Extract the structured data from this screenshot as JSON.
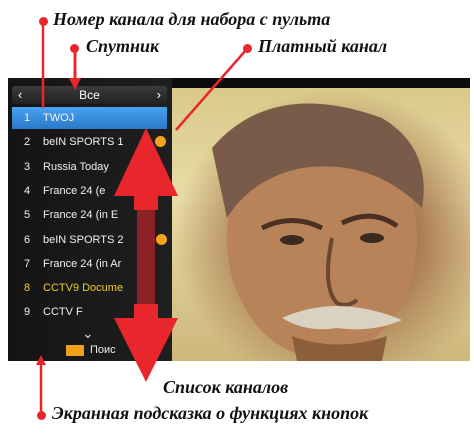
{
  "annotations": {
    "channel_number": "Номер канала для набора с пульта",
    "satellite": "Спутник",
    "paid_channel": "Платный канал",
    "channel_list": "Список каналов",
    "button_hint": "Экранная подсказка о функциях кнопок"
  },
  "satellite_selector": {
    "label": "Все",
    "prev_icon": "chevron-left-icon",
    "next_icon": "chevron-right-icon"
  },
  "channels": [
    {
      "num": "1",
      "name": "TWOJ",
      "selected": true,
      "paid": false
    },
    {
      "num": "2",
      "name": "beIN SPORTS 1",
      "selected": false,
      "paid": true
    },
    {
      "num": "3",
      "name": "Russia Today",
      "selected": false,
      "paid": false
    },
    {
      "num": "4",
      "name": "France 24 (e",
      "selected": false,
      "paid": false
    },
    {
      "num": "5",
      "name": "France 24 (in E",
      "selected": false,
      "paid": false
    },
    {
      "num": "6",
      "name": "beIN SPORTS 2",
      "selected": false,
      "paid": true
    },
    {
      "num": "7",
      "name": "France 24 (in Ar",
      "selected": false,
      "paid": false
    },
    {
      "num": "8",
      "name": "CCTV9 Docume",
      "selected": false,
      "paid": false,
      "highlight": true
    },
    {
      "num": "9",
      "name": "CCTV F",
      "selected": false,
      "paid": false
    }
  ],
  "scroll_down_icon": "chevron-down-icon",
  "hint": {
    "key_color": "#f0a21a",
    "label": "Поис"
  },
  "colors": {
    "selection": "#3a8fe0",
    "paid_dot": "#f5a31e",
    "annotation_dot": "#e8262b",
    "arrow": "#e8262b"
  }
}
